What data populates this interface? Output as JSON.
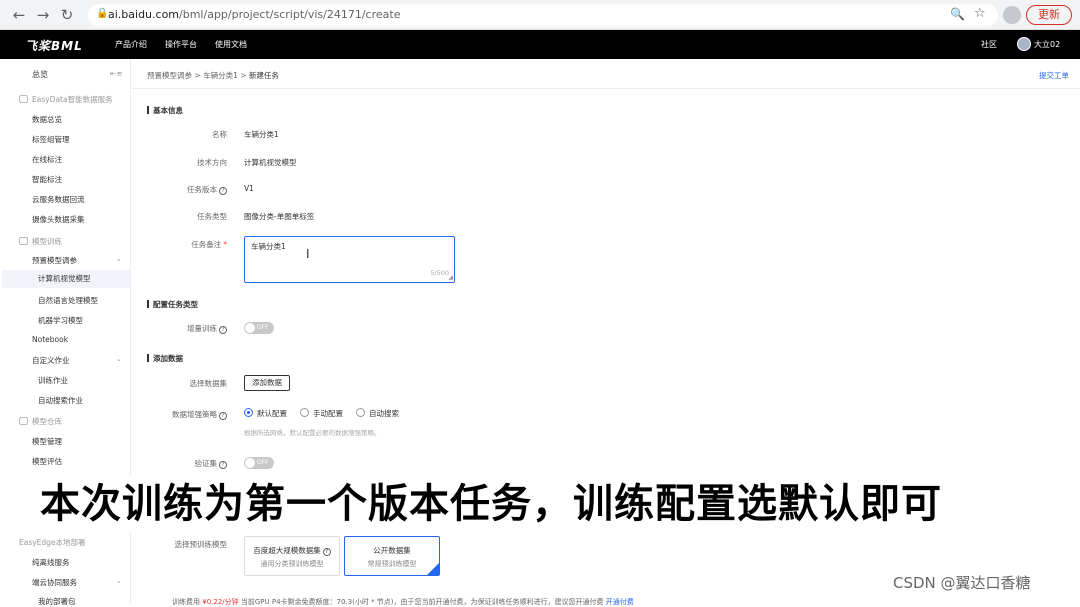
{
  "browser": {
    "url_host": "ai.baidu.com",
    "url_path": "/bml/app/project/script/vis/24171/create",
    "update_label": "更新"
  },
  "topnav": {
    "logo": "飞桨BML",
    "items": [
      "产品介绍",
      "操作平台",
      "使用文档"
    ],
    "community": "社区",
    "username": "大立02"
  },
  "sidebar": {
    "overview": "总览",
    "easydata_group": "EasyData智能数据服务",
    "easydata_items": [
      "数据总览",
      "标签组管理",
      "在线标注",
      "智能标注",
      "云服务数据回流",
      "摄像头数据采集"
    ],
    "model_train_group": "模型训练",
    "preset_tuning": "预置模型调参",
    "preset_items": [
      "计算机视觉模型",
      "自然语言处理模型",
      "机器学习模型"
    ],
    "notebook": "Notebook",
    "custom_job": "自定义作业",
    "custom_items": [
      "训练作业",
      "自动搜索作业"
    ],
    "model_repo_group": "模型仓库",
    "model_repo_items": [
      "模型管理",
      "模型评估"
    ],
    "edge_group": "EasyEdge本地部署",
    "edge_items": [
      "纯离线服务",
      "端云协同服务",
      "我的部署包"
    ]
  },
  "breadcrumb": {
    "items": [
      "预置模型调参",
      "车辆分类1"
    ],
    "current": "新建任务",
    "separator": ">"
  },
  "ticket_link": "提交工单",
  "basic_info": {
    "title": "基本信息",
    "name_label": "名称",
    "name_value": "车辆分类1",
    "direction_label": "技术方向",
    "direction_value": "计算机视觉模型",
    "version_label": "任务版本",
    "version_value": "V1",
    "type_label": "任务类型",
    "type_value": "图像分类-单图单标签",
    "note_label": "任务备注",
    "note_value": "车辆分类1",
    "note_count": "5/500"
  },
  "config": {
    "title": "配置任务类型",
    "incremental_label": "增量训练",
    "toggle_off": "OFF"
  },
  "add_data": {
    "title": "添加数据",
    "select_label": "选择数据集",
    "add_button": "添加数据",
    "strategy_label": "数据增强策略",
    "strategy_options": [
      "默认配置",
      "手动配置",
      "自动搜索"
    ],
    "strategy_selected": "默认配置",
    "hint": "根据所选网络，默认配置必要的数据增强策略。",
    "validation_label": "验证集"
  },
  "pretrain": {
    "label": "选择预训练模型",
    "cards": [
      {
        "title": "百度超大规模数据集",
        "subtitle": "通用分类预训练模型"
      },
      {
        "title": "公开数据集",
        "subtitle": "常规预训练模型"
      }
    ]
  },
  "bottom": {
    "fee_label": "训练费用",
    "fee_value": "¥0.22/分钟",
    "notice": "当前GPU P4卡剩余免费额度：70.3(小时 * 节点)，由于您当前开通付费，为保证训练任务顺利进行，建议您开通付费",
    "link": "开通付费"
  },
  "subtitle_caption": "本次训练为第一个版本任务，训练配置选默认即可",
  "watermark": "CSDN @翼达口香糖"
}
